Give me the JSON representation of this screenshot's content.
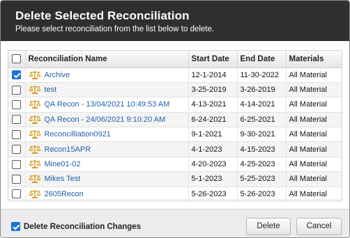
{
  "dialog": {
    "title": "Delete Selected Reconciliation",
    "subtitle": "Please select reconciliation from the list below to delete."
  },
  "grid": {
    "columns": {
      "name": "Reconciliation Name",
      "start": "Start Date",
      "end": "End Date",
      "materials": "Materials"
    },
    "select_all_checked": false,
    "row_icon": "scale-icon",
    "rows": [
      {
        "checked": true,
        "name": "Archive",
        "start": "12-1-2014",
        "end": "11-30-2022",
        "materials": "All Material"
      },
      {
        "checked": false,
        "name": "test",
        "start": "3-25-2019",
        "end": "3-26-2019",
        "materials": "All Material"
      },
      {
        "checked": false,
        "name": "QA Recon - 13/04/2021 10:49:53 AM",
        "start": "4-13-2021",
        "end": "4-14-2021",
        "materials": "All Material"
      },
      {
        "checked": false,
        "name": "QA Recon - 24/06/2021 9:10:20 AM",
        "start": "6-24-2021",
        "end": "6-25-2021",
        "materials": "All Material"
      },
      {
        "checked": false,
        "name": "Reconcilliation0921",
        "start": "9-1-2021",
        "end": "9-30-2021",
        "materials": "All Material"
      },
      {
        "checked": false,
        "name": "Recon15APR",
        "start": "4-1-2023",
        "end": "4-15-2023",
        "materials": "All Material"
      },
      {
        "checked": false,
        "name": "Mine01-02",
        "start": "4-20-2023",
        "end": "4-25-2023",
        "materials": "All Material"
      },
      {
        "checked": false,
        "name": "Mikes Test",
        "start": "5-1-2023",
        "end": "5-25-2023",
        "materials": "All Material"
      },
      {
        "checked": false,
        "name": "2605Recon",
        "start": "5-26-2023",
        "end": "5-26-2023",
        "materials": "All Material"
      }
    ]
  },
  "footer": {
    "delete_changes_label": "Delete Reconciliation Changes",
    "delete_changes_checked": true,
    "delete_label": "Delete",
    "cancel_label": "Cancel"
  },
  "colors": {
    "header_bg": "#2f2f2f",
    "link": "#1f5fa8",
    "checkbox_accent": "#1a73d9",
    "icon_gold": "#d99a1c"
  }
}
